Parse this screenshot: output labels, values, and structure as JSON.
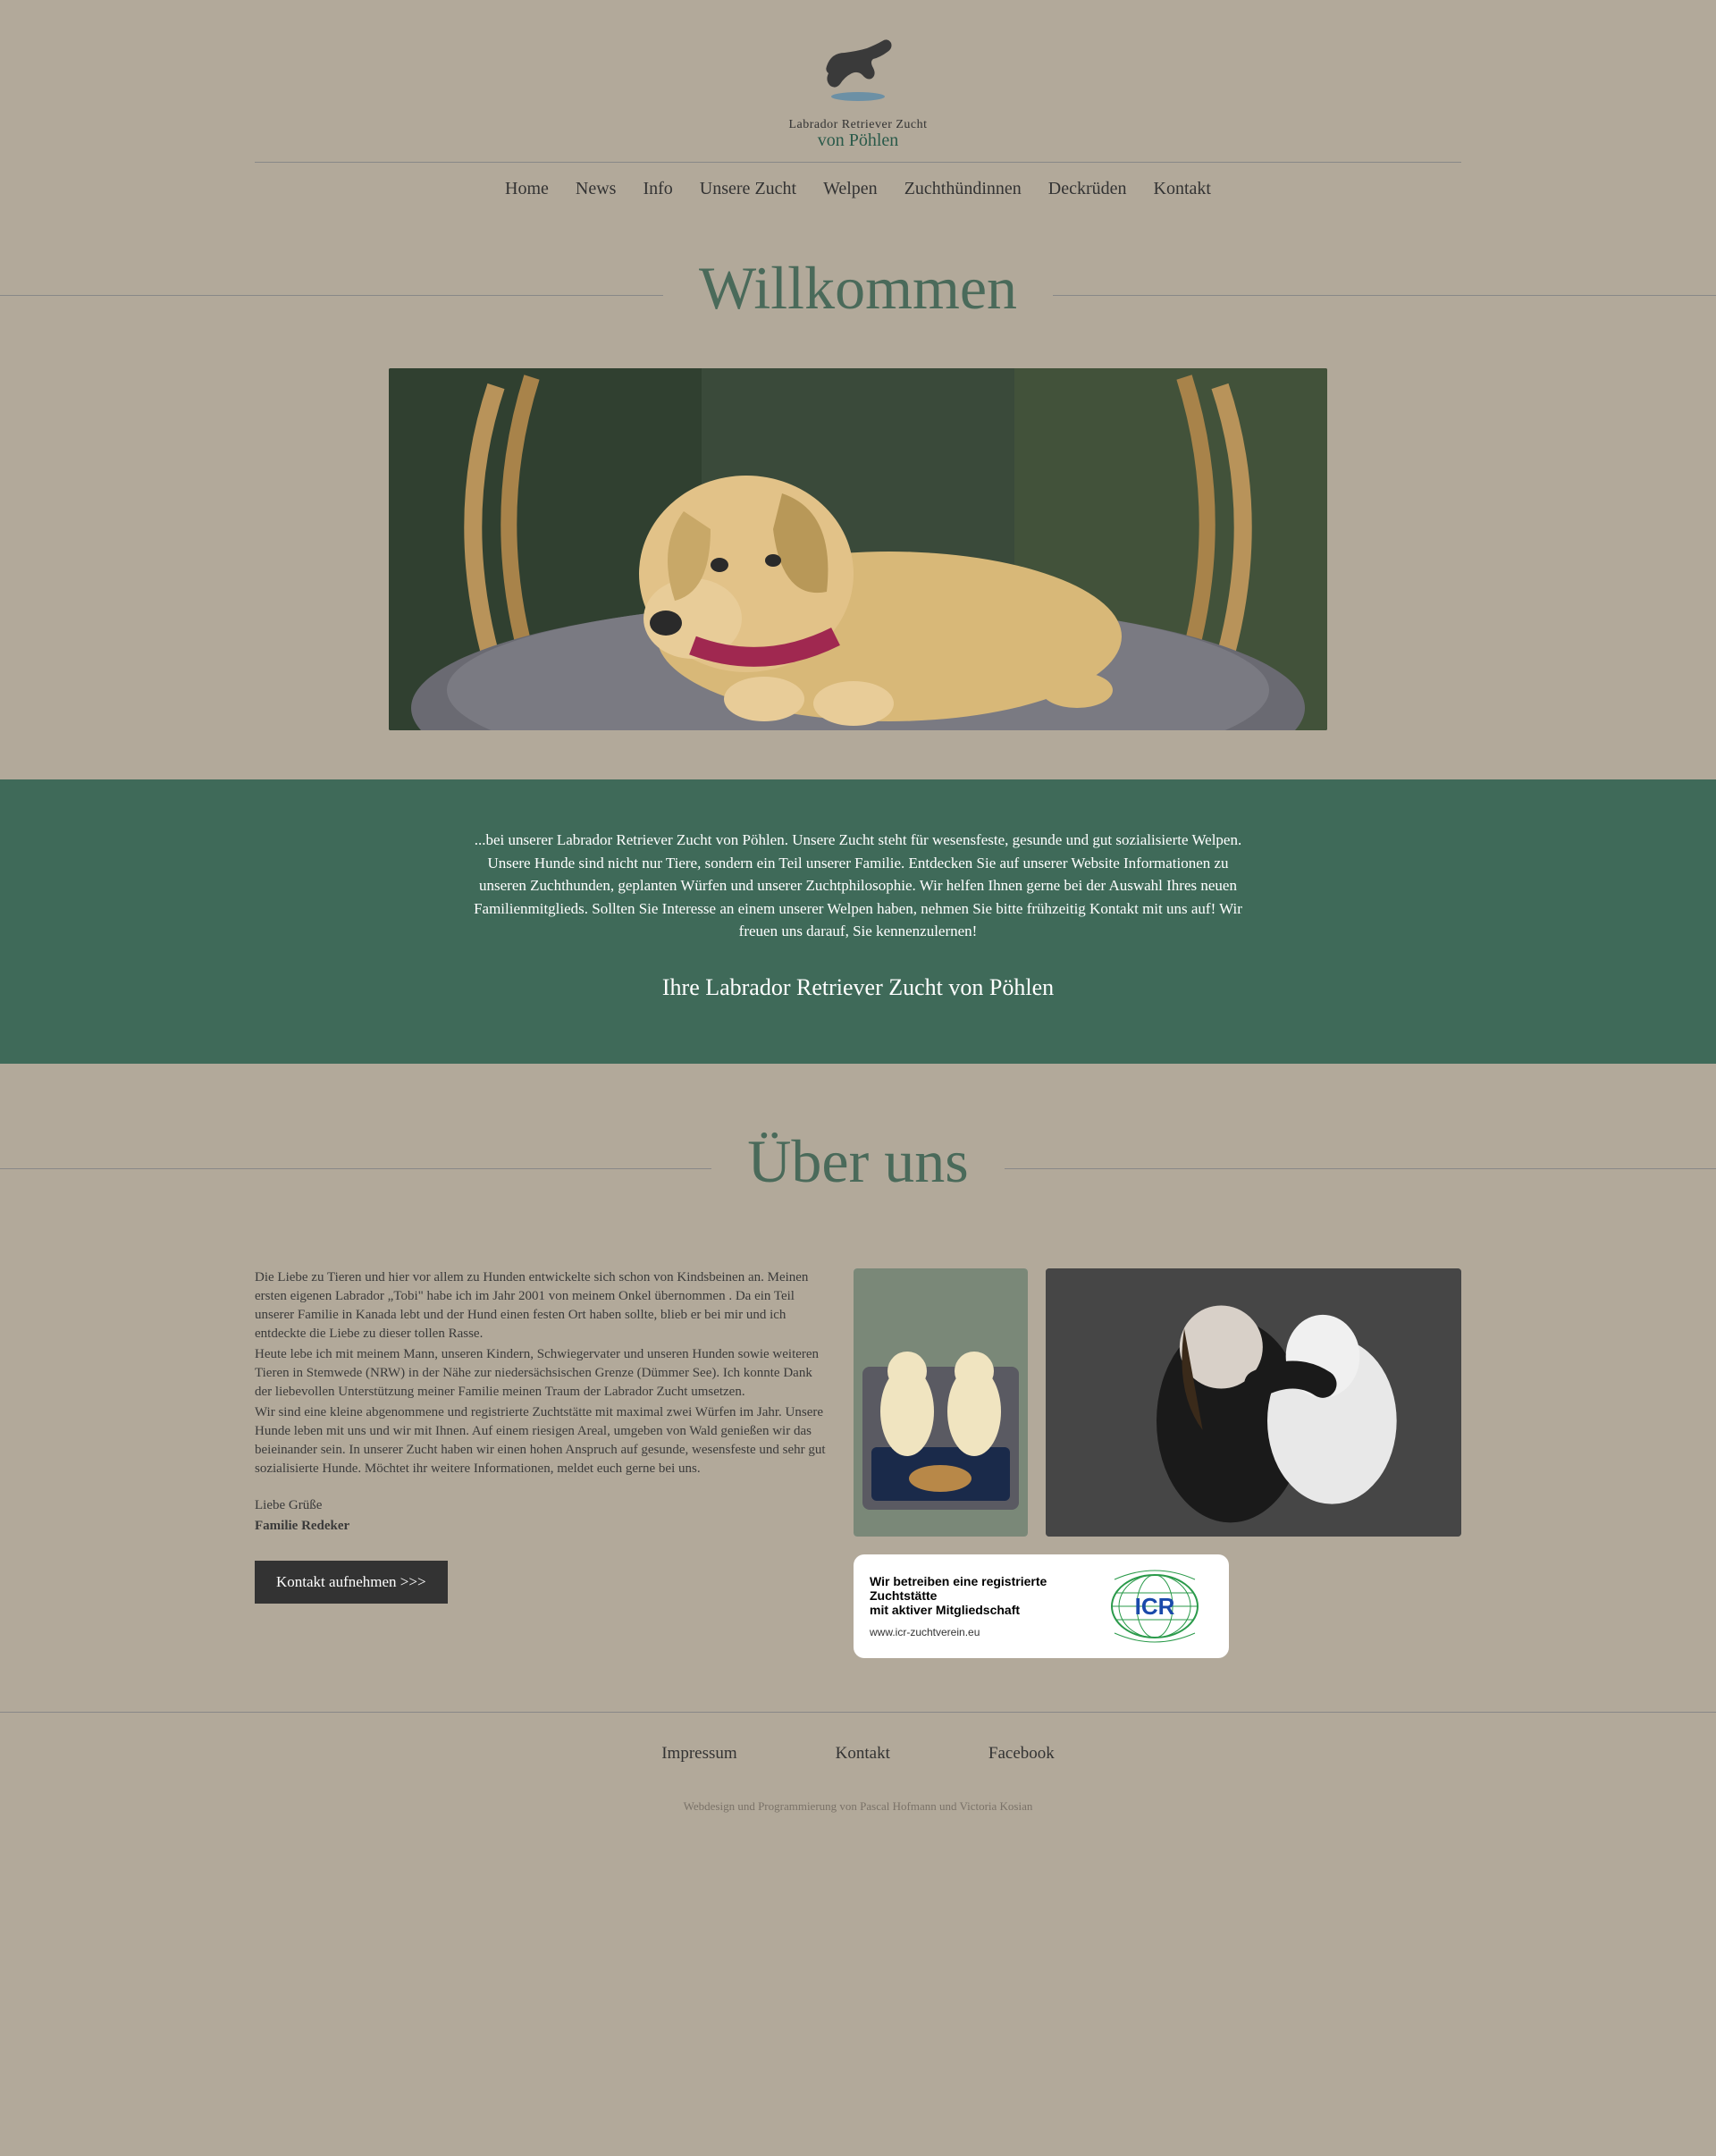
{
  "logo": {
    "line1": "Labrador Retriever Zucht",
    "line2": "von Pöhlen"
  },
  "nav": {
    "items": [
      "Home",
      "News",
      "Info",
      "Unsere Zucht",
      "Welpen",
      "Zuchthündinnen",
      "Deckrüden",
      "Kontakt"
    ]
  },
  "section1": {
    "heading": "Willkommen"
  },
  "green": {
    "text": "...bei unserer Labrador Retriever Zucht von Pöhlen. Unsere Zucht steht für wesensfeste, gesunde und gut sozialisierte Welpen. Unsere Hunde sind nicht nur Tiere, sondern ein Teil unserer Familie. Entdecken Sie auf unserer Website Informationen zu unseren Zuchthunden, geplanten Würfen und unserer Zuchtphilosophie. Wir helfen Ihnen gerne bei der Auswahl Ihres neuen Familienmitglieds. Sollten Sie Interesse an einem unserer Welpen haben, nehmen Sie bitte frühzeitig Kontakt mit uns auf! Wir freuen uns darauf, Sie kennenzulernen!",
    "signature": "Ihre Labrador Retriever Zucht von Pöhlen"
  },
  "section2": {
    "heading": "Über uns"
  },
  "about": {
    "p1": "Die Liebe zu Tieren und hier vor allem zu Hunden entwickelte sich schon von Kindsbeinen an. Meinen ersten eigenen Labrador „Tobi\" habe ich im Jahr 2001 von meinem Onkel übernommen . Da ein Teil unserer Familie in Kanada lebt und der Hund einen festen Ort haben sollte, blieb er bei mir und ich entdeckte die Liebe zu dieser tollen Rasse.",
    "p2": "Heute lebe ich mit meinem Mann, unseren Kindern, Schwiegervater und unseren Hunden sowie weiteren Tieren in Stemwede (NRW) in der Nähe zur niedersächsischen Grenze (Dümmer See). Ich konnte Dank der liebevollen Unterstützung meiner Familie meinen Traum der Labrador Zucht umsetzen.",
    "p3": "Wir sind eine kleine abgenommene und registrierte Zuchtstätte mit maximal zwei Würfen im Jahr. Unsere Hunde leben mit uns und wir mit Ihnen. Auf einem riesigen Areal, umgeben von Wald genießen wir das beieinander sein. In unserer Zucht haben wir einen hohen Anspruch auf gesunde, wesensfeste und sehr gut sozialisierte Hunde. Möchtet ihr weitere Informationen, meldet euch gerne bei uns.",
    "signoff": "Liebe Grüße",
    "family": "Familie Redeker",
    "button": "Kontakt aufnehmen >>>"
  },
  "badge": {
    "line1": "Wir betreiben eine registrierte Zuchtstätte",
    "line2": "mit aktiver Mitgliedschaft",
    "url": "www.icr-zuchtverein.eu",
    "org": "ICR"
  },
  "footer": {
    "links": [
      "Impressum",
      "Kontakt",
      "Facebook"
    ],
    "credit": "Webdesign und Programmierung von Pascal Hofmann und Victoria Kosian"
  },
  "colors": {
    "pageBg": "#b2a99a",
    "greenBlock": "#3f6a59",
    "headingGreen": "#4a6a5a",
    "buttonBg": "#333333"
  }
}
